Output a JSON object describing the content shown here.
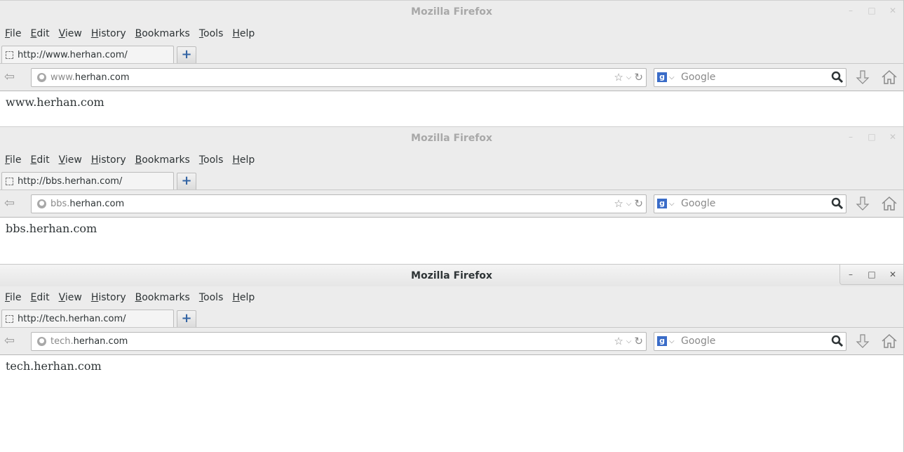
{
  "windows": [
    {
      "title": "Mozilla Firefox",
      "active": false,
      "menu": [
        "File",
        "Edit",
        "View",
        "History",
        "Bookmarks",
        "Tools",
        "Help"
      ],
      "tab_title": "http://www.herhan.com/",
      "url_sub": "www.",
      "url_domain": "herhan.com",
      "search_placeholder": "Google",
      "page_text": "www.herhan.com"
    },
    {
      "title": "Mozilla Firefox",
      "active": false,
      "menu": [
        "File",
        "Edit",
        "View",
        "History",
        "Bookmarks",
        "Tools",
        "Help"
      ],
      "tab_title": "http://bbs.herhan.com/",
      "url_sub": "bbs.",
      "url_domain": "herhan.com",
      "search_placeholder": "Google",
      "page_text": "bbs.herhan.com"
    },
    {
      "title": "Mozilla Firefox",
      "active": true,
      "menu": [
        "File",
        "Edit",
        "View",
        "History",
        "Bookmarks",
        "Tools",
        "Help"
      ],
      "tab_title": "http://tech.herhan.com/",
      "url_sub": "tech.",
      "url_domain": "herhan.com",
      "search_placeholder": "Google",
      "page_text": "tech.herhan.com"
    }
  ],
  "icons": {
    "minimize": "minimize-icon",
    "maximize": "maximize-icon",
    "close": "close-icon",
    "new_tab": "plus-icon",
    "back": "back-arrow-icon",
    "site_identity": "globe-icon",
    "bookmark": "star-icon",
    "history_dropdown": "chevron-down-icon",
    "reload": "reload-icon",
    "search_engine": "google-icon",
    "search": "magnifier-icon",
    "downloads": "download-arrow-icon",
    "home": "home-icon"
  },
  "colors": {
    "accent": "#3465a4",
    "search_engine": "#3a6cc8",
    "inactive_title": "#a8a8a8",
    "active_title": "#2e3436"
  }
}
